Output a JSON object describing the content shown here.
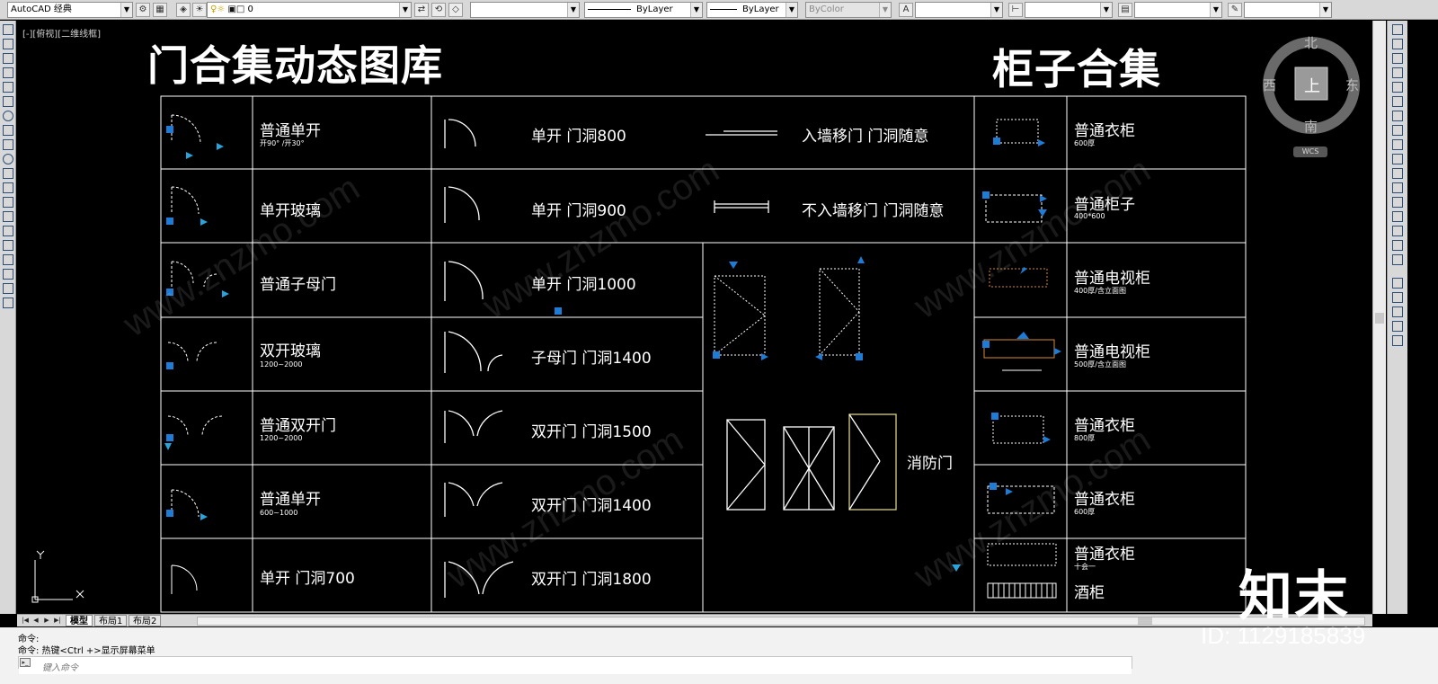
{
  "toolbar": {
    "workspace": "AutoCAD 经典",
    "layer": "0",
    "linetype1": "ByLayer",
    "linetype2": "ByLayer",
    "color": "ByColor"
  },
  "view_label": "[-][俯视][二维线框]",
  "titles": {
    "doors": "门合集动态图库",
    "cabinets": "柜子合集"
  },
  "compass": {
    "north": "北",
    "south": "南",
    "east": "东",
    "west": "西",
    "center": "上",
    "wcs": "WCS"
  },
  "door_column": [
    {
      "label": "普通单开",
      "sub": "开90° /开30°"
    },
    {
      "label": "单开玻璃",
      "sub": ""
    },
    {
      "label": "普通子母门",
      "sub": ""
    },
    {
      "label": "双开玻璃",
      "sub": "1200~2000"
    },
    {
      "label": "普通双开门",
      "sub": "1200~2000"
    },
    {
      "label": "普通单开",
      "sub": "600~1000"
    },
    {
      "label": "单开 门洞700",
      "sub": ""
    }
  ],
  "opening_column": [
    {
      "label": "单开 门洞800"
    },
    {
      "label": "单开 门洞900"
    },
    {
      "label": "单开 门洞1000"
    },
    {
      "label": "子母门 门洞1400"
    },
    {
      "label": "双开门 门洞1500"
    },
    {
      "label": "双开门 门洞1400"
    },
    {
      "label": "双开门 门洞1800"
    }
  ],
  "sliding": [
    {
      "label": "入墙移门 门洞随意"
    },
    {
      "label": "不入墙移门 门洞随意"
    }
  ],
  "fire_door": {
    "label": "消防门"
  },
  "cabinet_column": [
    {
      "label": "普通衣柜",
      "sub": "600厚"
    },
    {
      "label": "普通柜子",
      "sub": "400*600"
    },
    {
      "label": "普通电视柜",
      "sub": "400厚/含立面图"
    },
    {
      "label": "普通电视柜",
      "sub": "500厚/含立面图"
    },
    {
      "label": "普通衣柜",
      "sub": "800厚"
    },
    {
      "label": "普通衣柜",
      "sub": "600厚"
    },
    {
      "label": "普通衣柜",
      "sub": "十会一"
    },
    {
      "label": "酒柜",
      "sub": ""
    }
  ],
  "tabs": {
    "model": "模型",
    "layout1": "布局1",
    "layout2": "布局2"
  },
  "command": {
    "line1": "命令:",
    "line2": "命令: 热键<Ctrl +>显示屏幕菜单",
    "placeholder": "键入命令"
  },
  "watermark": {
    "logo": "知末",
    "id": "ID: 1129185839",
    "site": "www.znzmo.com"
  },
  "colors": {
    "accent_blue": "#1e7bd6",
    "cyan_arrow": "#29a3d9",
    "frame": "#ffffff",
    "dim_orange": "#d98a3a"
  }
}
